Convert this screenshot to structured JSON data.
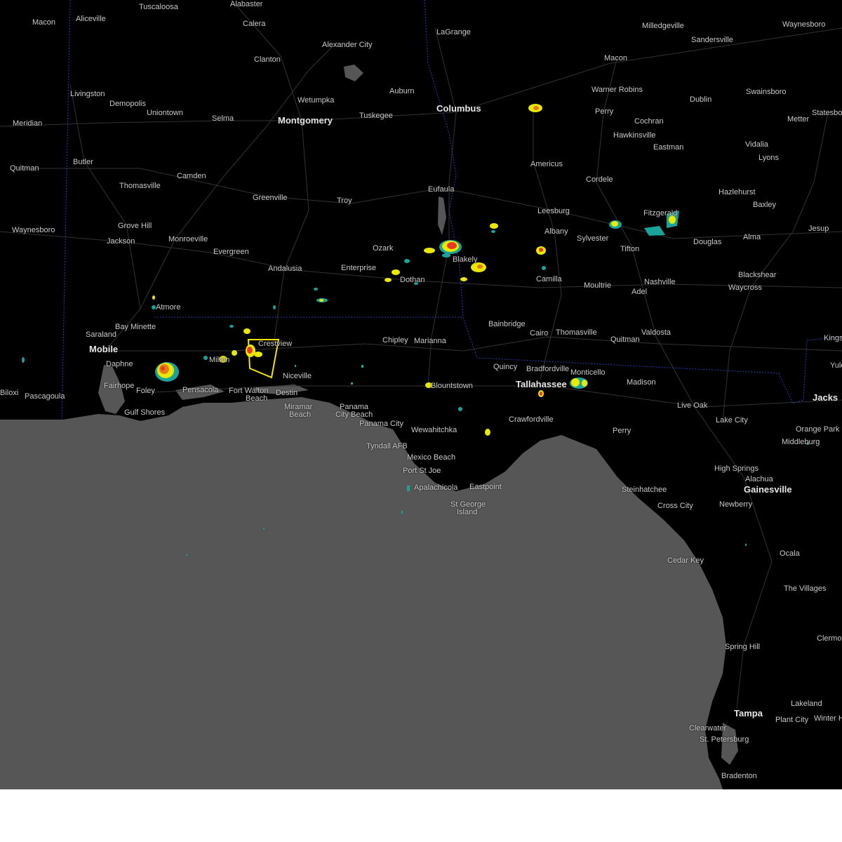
{
  "map": {
    "colors": {
      "land": "#000000",
      "water": "#565656",
      "state_border": "#2a3fb0",
      "roads": "#3a3a3a",
      "warning_polygon": "#f5e400",
      "radar_light": "#1aa39a",
      "radar_mid": "#e8e800",
      "radar_heavy": "#e83b1e"
    },
    "cities": [
      {
        "name": "Tuscaloosa"
      },
      {
        "name": "Alabaster"
      },
      {
        "name": "LaGrange"
      },
      {
        "name": "Milledgeville"
      },
      {
        "name": "Waynesboro"
      },
      {
        "name": "Macon"
      },
      {
        "name": "Aliceville"
      },
      {
        "name": "Calera"
      },
      {
        "name": "Alexander City"
      },
      {
        "name": "Sandersville"
      },
      {
        "name": "Clanton"
      },
      {
        "name": "Macon"
      },
      {
        "name": "Livingston"
      },
      {
        "name": "Demopolis"
      },
      {
        "name": "Auburn"
      },
      {
        "name": "Warner Robins"
      },
      {
        "name": "Swainsboro"
      },
      {
        "name": "Wetumpka"
      },
      {
        "name": "Dublin"
      },
      {
        "name": "Uniontown"
      },
      {
        "name": "Columbus"
      },
      {
        "name": "Perry"
      },
      {
        "name": "Statesboro"
      },
      {
        "name": "Tuskegee"
      },
      {
        "name": "Meridian"
      },
      {
        "name": "Selma"
      },
      {
        "name": "Montgomery"
      },
      {
        "name": "Cochran"
      },
      {
        "name": "Metter"
      },
      {
        "name": "Hawkinsville"
      },
      {
        "name": "Vidalia"
      },
      {
        "name": "Eastman"
      },
      {
        "name": "Butler"
      },
      {
        "name": "Lyons"
      },
      {
        "name": "Americus"
      },
      {
        "name": "Quitman"
      },
      {
        "name": "Camden"
      },
      {
        "name": "Cordele"
      },
      {
        "name": "Thomasville"
      },
      {
        "name": "Eufaula"
      },
      {
        "name": "Greenville"
      },
      {
        "name": "Hazlehurst"
      },
      {
        "name": "Troy"
      },
      {
        "name": "Fitzgerald"
      },
      {
        "name": "Baxley"
      },
      {
        "name": "Leesburg"
      },
      {
        "name": "Grove Hill"
      },
      {
        "name": "Jesup"
      },
      {
        "name": "Waynesboro"
      },
      {
        "name": "Albany"
      },
      {
        "name": "Douglas"
      },
      {
        "name": "Alma"
      },
      {
        "name": "Monroeville"
      },
      {
        "name": "Sylvester"
      },
      {
        "name": "Jackson"
      },
      {
        "name": "Ozark"
      },
      {
        "name": "Tifton"
      },
      {
        "name": "Evergreen"
      },
      {
        "name": "Blakely"
      },
      {
        "name": "Enterprise"
      },
      {
        "name": "Andalusia"
      },
      {
        "name": "Blackshear"
      },
      {
        "name": "Camilla"
      },
      {
        "name": "Dothan"
      },
      {
        "name": "Nashville"
      },
      {
        "name": "Waycross"
      },
      {
        "name": "Moultrie"
      },
      {
        "name": "Adel"
      },
      {
        "name": "Atmore"
      },
      {
        "name": "Bay Minette"
      },
      {
        "name": "Bainbridge"
      },
      {
        "name": "Valdosta"
      },
      {
        "name": "Saraland"
      },
      {
        "name": "Cairo"
      },
      {
        "name": "Thomasville"
      },
      {
        "name": "Quitman"
      },
      {
        "name": "Kings"
      },
      {
        "name": "Chipley"
      },
      {
        "name": "Marianna"
      },
      {
        "name": "Crestview"
      },
      {
        "name": "Mobile"
      },
      {
        "name": "Milton"
      },
      {
        "name": "Daphne"
      },
      {
        "name": "Quincy"
      },
      {
        "name": "Bradfordville"
      },
      {
        "name": "Monticello"
      },
      {
        "name": "Yule"
      },
      {
        "name": "Niceville"
      },
      {
        "name": "Fairhope"
      },
      {
        "name": "Madison"
      },
      {
        "name": "Tallahassee"
      },
      {
        "name": "Foley"
      },
      {
        "name": "Pensacola"
      },
      {
        "name": "Fort Walton"
      },
      {
        "name": "Blountstown"
      },
      {
        "name": "Biloxi"
      },
      {
        "name": "Pascagoula"
      },
      {
        "name": "Destin"
      },
      {
        "name": "Beach"
      },
      {
        "name": "Jacks"
      },
      {
        "name": "Live Oak"
      },
      {
        "name": "Miramar"
      },
      {
        "name": "Gulf Shores"
      },
      {
        "name": "Beach"
      },
      {
        "name": "Panama"
      },
      {
        "name": "City Beach"
      },
      {
        "name": "Lake City"
      },
      {
        "name": "Orange Park"
      },
      {
        "name": "Panama City"
      },
      {
        "name": "Crawfordville"
      },
      {
        "name": "Wewahitchka"
      },
      {
        "name": "Perry"
      },
      {
        "name": "Middleburg"
      },
      {
        "name": "Tyndall AFB"
      },
      {
        "name": "Mexico Beach"
      },
      {
        "name": "Port St Joe"
      },
      {
        "name": "High Springs"
      },
      {
        "name": "Alachua"
      },
      {
        "name": "Apalachicola"
      },
      {
        "name": "Eastpoint"
      },
      {
        "name": "Steinhatchee"
      },
      {
        "name": "Gainesville"
      },
      {
        "name": "St George"
      },
      {
        "name": "Island"
      },
      {
        "name": "Cross City"
      },
      {
        "name": "Newberry"
      },
      {
        "name": "Cedar Key"
      },
      {
        "name": "Ocala"
      },
      {
        "name": "The Villages"
      },
      {
        "name": "Clermo"
      },
      {
        "name": "Spring Hill"
      },
      {
        "name": "Tampa"
      },
      {
        "name": "Lakeland"
      },
      {
        "name": "Clearwater"
      },
      {
        "name": "Plant City"
      },
      {
        "name": "Winter H"
      },
      {
        "name": "St. Petersburg"
      },
      {
        "name": "Bradenton"
      }
    ]
  }
}
